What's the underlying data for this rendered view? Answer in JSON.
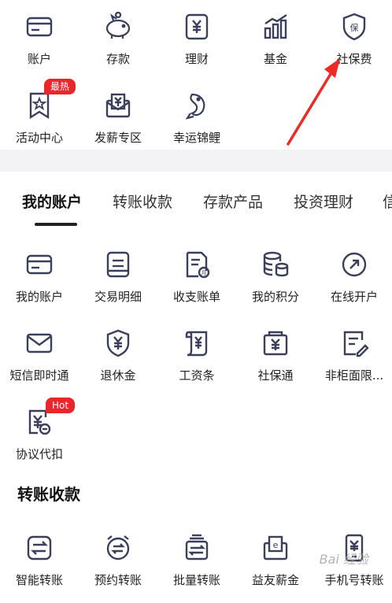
{
  "top_grid": [
    {
      "label": "账户",
      "icon": "card-icon"
    },
    {
      "label": "存款",
      "icon": "piggy-bank-icon"
    },
    {
      "label": "理财",
      "icon": "yuan-doc-icon"
    },
    {
      "label": "基金",
      "icon": "bar-chart-icon"
    },
    {
      "label": "社保费",
      "icon": "shield-bao-icon"
    },
    {
      "label": "活动中心",
      "icon": "star-bookmark-icon"
    },
    {
      "label": "发薪专区",
      "icon": "salary-envelope-icon"
    },
    {
      "label": "幸运锦鲤",
      "icon": "koi-fish-icon"
    }
  ],
  "badges": {
    "activity": "最热",
    "agreement": "Hot"
  },
  "tabs": [
    "我的账户",
    "转账收款",
    "存款产品",
    "投资理财",
    "信"
  ],
  "account_grid": [
    {
      "label": "我的账户",
      "icon": "card-icon"
    },
    {
      "label": "交易明细",
      "icon": "list-doc-icon"
    },
    {
      "label": "收支账单",
      "icon": "bill-icon"
    },
    {
      "label": "我的积分",
      "icon": "coins-icon"
    },
    {
      "label": "在线开户",
      "icon": "open-account-icon"
    },
    {
      "label": "短信即时通",
      "icon": "envelope-icon"
    },
    {
      "label": "退休金",
      "icon": "shield-yuan-icon"
    },
    {
      "label": "工资条",
      "icon": "scroll-icon"
    },
    {
      "label": "社保通",
      "icon": "social-security-icon"
    },
    {
      "label": "非柜面限...",
      "icon": "edit-doc-icon"
    },
    {
      "label": "协议代扣",
      "icon": "agreement-icon"
    }
  ],
  "transfer_section": {
    "title": "转账收款",
    "items": [
      {
        "label": "智能转账",
        "icon": "smart-transfer-icon"
      },
      {
        "label": "预约转账",
        "icon": "alarm-transfer-icon"
      },
      {
        "label": "批量转账",
        "icon": "batch-transfer-icon"
      },
      {
        "label": "益友薪金",
        "icon": "salary-e-icon"
      },
      {
        "label": "手机号转账",
        "icon": "phone-transfer-icon"
      }
    ]
  },
  "watermark": "Bai 经验",
  "colors": {
    "accent": "#e8262b",
    "icon": "#3a3f5c",
    "divider": "#f3f3f5"
  }
}
